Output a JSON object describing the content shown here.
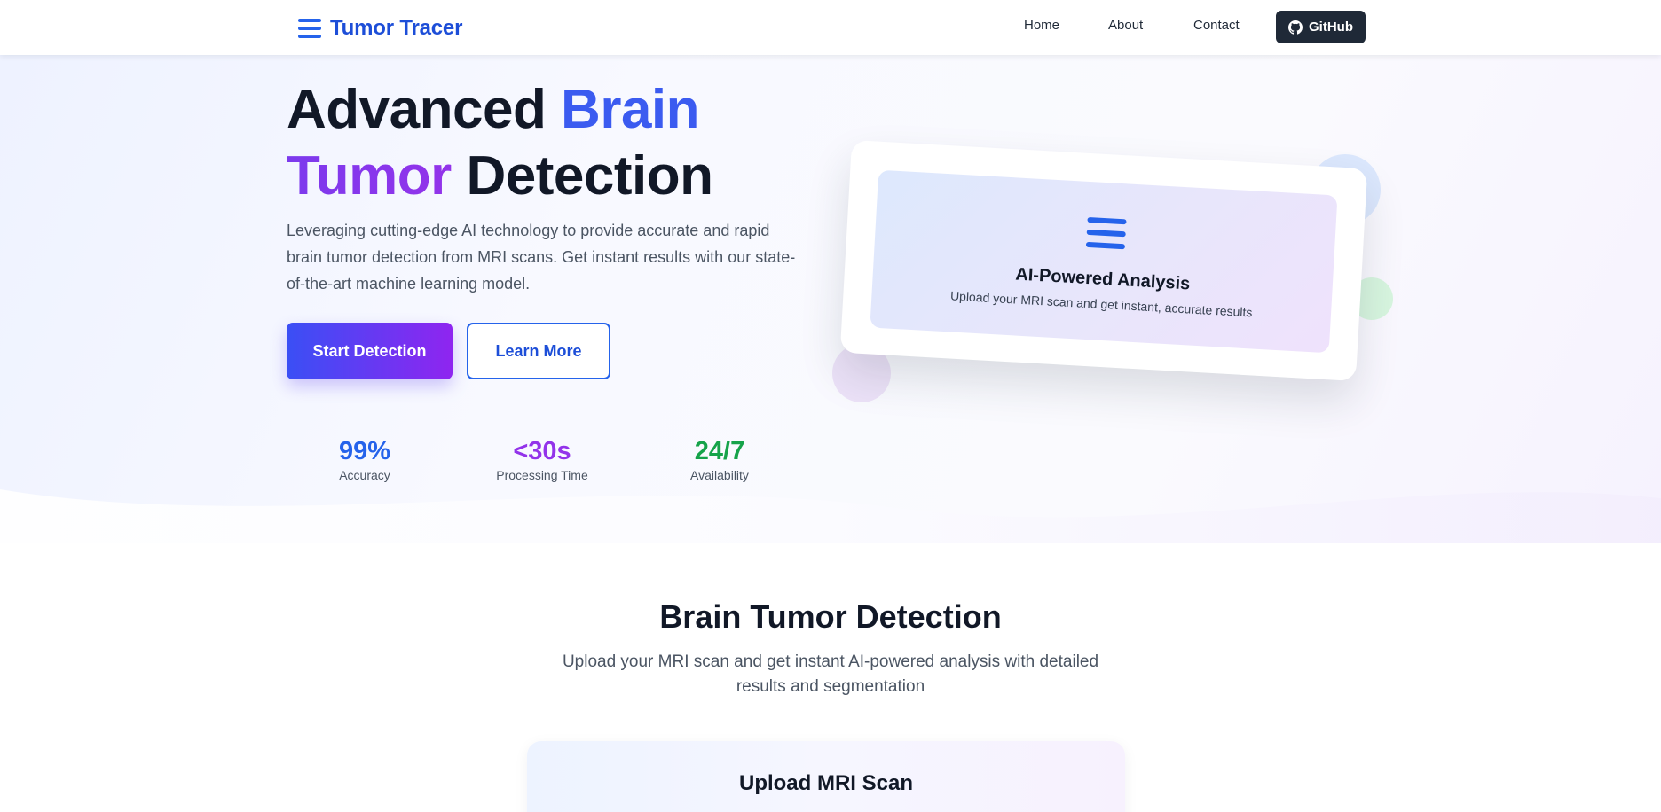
{
  "nav": {
    "brand": "Tumor Tracer",
    "links": [
      "Home",
      "About",
      "Contact"
    ],
    "github_label": "GitHub"
  },
  "hero": {
    "title_line1_part1": "Advanced ",
    "title_line1_part2": "Brain",
    "title_line2_part1": "Tumor",
    "title_line2_part2": " Detection",
    "description": "Leveraging cutting-edge AI technology to provide accurate and rapid brain tumor detection from MRI scans. Get instant results with our state-of-the-art machine learning model.",
    "primary_button": "Start Detection",
    "secondary_button": "Learn More",
    "stats": [
      {
        "value": "99%",
        "label": "Accuracy",
        "color": "#2563eb"
      },
      {
        "value": "<30s",
        "label": "Processing Time",
        "color": "#9333ea"
      },
      {
        "value": "24/7",
        "label": "Availability",
        "color": "#16a34a"
      }
    ]
  },
  "feature_card": {
    "title": "AI-Powered Analysis",
    "subtitle": "Upload your MRI scan and get instant, accurate results"
  },
  "detection_section": {
    "title": "Brain Tumor Detection",
    "subtitle": "Upload your MRI scan and get instant AI-powered analysis with detailed results and segmentation",
    "upload_card_title": "Upload MRI Scan"
  },
  "colors": {
    "accent_blue": "#2563eb",
    "accent_purple": "#9333ea",
    "accent_green": "#16a34a",
    "dark": "#1f2937"
  }
}
